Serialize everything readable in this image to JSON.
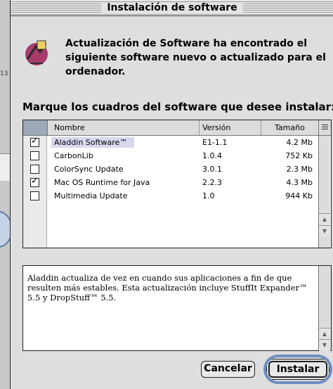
{
  "window": {
    "title": "Instalación de software"
  },
  "message": "Actualización de Software ha encontrado el siguiente software nuevo o actualizado para el ordenador.",
  "instruction": "Marque los cuadros del software que desee instalar:",
  "table": {
    "columns": {
      "name": "Nombre",
      "version": "Versión",
      "size": "Tamaño"
    },
    "rows": [
      {
        "checked": true,
        "name": "Aladdin Software™",
        "version": "E1-1.1",
        "size": "4.2 Mb"
      },
      {
        "checked": false,
        "name": "CarbonLib",
        "version": "1.0.4",
        "size": "752 Kb"
      },
      {
        "checked": false,
        "name": "ColorSync Update",
        "version": "3.0.1",
        "size": "2.3 Mb"
      },
      {
        "checked": true,
        "name": "Mac OS Runtime for Java",
        "version": "2.2.3",
        "size": "4.3 Mb"
      },
      {
        "checked": false,
        "name": "Multimedia Update",
        "version": "1.0",
        "size": "944 Kb"
      }
    ]
  },
  "description": "Aladdin actualiza de vez en cuando sus aplicaciones a fin de que resulten más estables. Esta actualización incluye StuffIt Expander™ 5.5 y DropStuff™ 5.5.",
  "buttons": {
    "cancel": "Cancelar",
    "install": "Instalar"
  },
  "background": {
    "left_label": "13"
  },
  "colors": {
    "highlight_ring": "#6f8fc0",
    "selection": "#d8d8ef"
  }
}
